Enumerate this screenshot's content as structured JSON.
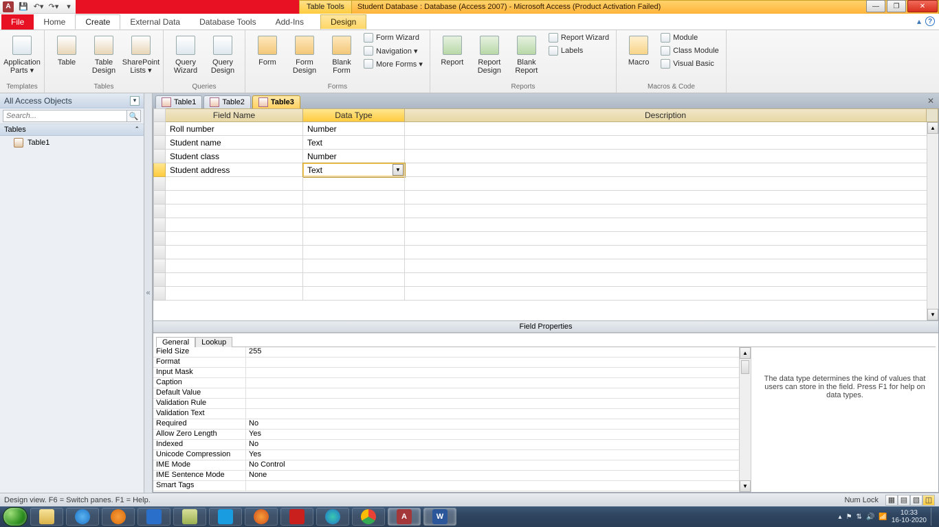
{
  "titlebar": {
    "tools_label": "Table Tools",
    "title": "Student Database : Database (Access 2007)  -  Microsoft Access (Product Activation Failed)"
  },
  "ribbon_tabs": {
    "file": "File",
    "home": "Home",
    "create": "Create",
    "external": "External Data",
    "dbtools": "Database Tools",
    "addins": "Add-Ins",
    "design": "Design"
  },
  "ribbon": {
    "templates": {
      "app_parts": "Application\nParts ▾",
      "label": "Templates"
    },
    "tables": {
      "table": "Table",
      "table_design": "Table\nDesign",
      "sp_lists": "SharePoint\nLists ▾",
      "label": "Tables"
    },
    "queries": {
      "qwizard": "Query\nWizard",
      "qdesign": "Query\nDesign",
      "label": "Queries"
    },
    "forms": {
      "form": "Form",
      "form_design": "Form\nDesign",
      "blank_form": "Blank\nForm",
      "form_wizard": "Form Wizard",
      "navigation": "Navigation ▾",
      "more_forms": "More Forms ▾",
      "label": "Forms"
    },
    "reports": {
      "report": "Report",
      "report_design": "Report\nDesign",
      "blank_report": "Blank\nReport",
      "report_wizard": "Report Wizard",
      "labels": "Labels",
      "label": "Reports"
    },
    "macros": {
      "macro": "Macro",
      "module": "Module",
      "class_module": "Class Module",
      "visual_basic": "Visual Basic",
      "label": "Macros & Code"
    }
  },
  "navpane": {
    "header": "All Access Objects",
    "search_placeholder": "Search...",
    "section": "Tables",
    "items": [
      "Table1"
    ]
  },
  "doctabs": [
    "Table1",
    "Table2",
    "Table3"
  ],
  "design_grid": {
    "headers": {
      "field_name": "Field Name",
      "data_type": "Data Type",
      "description": "Description"
    },
    "rows": [
      {
        "field": "Roll number",
        "type": "Number"
      },
      {
        "field": "Student name",
        "type": "Text"
      },
      {
        "field": "Student class",
        "type": "Number"
      },
      {
        "field": "Student address",
        "type": "Text",
        "editing": true
      }
    ]
  },
  "field_properties": {
    "title": "Field Properties",
    "tabs": {
      "general": "General",
      "lookup": "Lookup"
    },
    "rows": [
      {
        "k": "Field Size",
        "v": "255"
      },
      {
        "k": "Format",
        "v": ""
      },
      {
        "k": "Input Mask",
        "v": ""
      },
      {
        "k": "Caption",
        "v": ""
      },
      {
        "k": "Default Value",
        "v": ""
      },
      {
        "k": "Validation Rule",
        "v": ""
      },
      {
        "k": "Validation Text",
        "v": ""
      },
      {
        "k": "Required",
        "v": "No"
      },
      {
        "k": "Allow Zero Length",
        "v": "Yes"
      },
      {
        "k": "Indexed",
        "v": "No"
      },
      {
        "k": "Unicode Compression",
        "v": "Yes"
      },
      {
        "k": "IME Mode",
        "v": "No Control"
      },
      {
        "k": "IME Sentence Mode",
        "v": "None"
      },
      {
        "k": "Smart Tags",
        "v": ""
      }
    ],
    "help": "The data type determines the kind of values that users can store in the field. Press F1 for help on data types."
  },
  "status": {
    "left": "Design view.  F6 = Switch panes.  F1 = Help.",
    "numlock": "Num Lock"
  },
  "tray": {
    "time": "10:33",
    "date": "16-10-2020"
  }
}
